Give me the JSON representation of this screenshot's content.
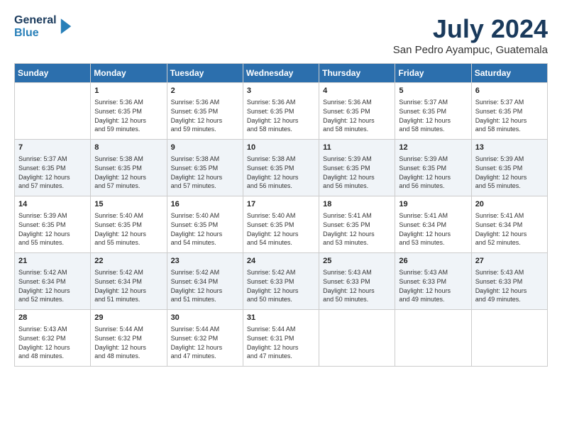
{
  "header": {
    "logo_line1": "General",
    "logo_line2": "Blue",
    "month": "July 2024",
    "location": "San Pedro Ayampuc, Guatemala"
  },
  "days_of_week": [
    "Sunday",
    "Monday",
    "Tuesday",
    "Wednesday",
    "Thursday",
    "Friday",
    "Saturday"
  ],
  "weeks": [
    [
      {
        "day": "",
        "content": ""
      },
      {
        "day": "1",
        "content": "Sunrise: 5:36 AM\nSunset: 6:35 PM\nDaylight: 12 hours\nand 59 minutes."
      },
      {
        "day": "2",
        "content": "Sunrise: 5:36 AM\nSunset: 6:35 PM\nDaylight: 12 hours\nand 59 minutes."
      },
      {
        "day": "3",
        "content": "Sunrise: 5:36 AM\nSunset: 6:35 PM\nDaylight: 12 hours\nand 58 minutes."
      },
      {
        "day": "4",
        "content": "Sunrise: 5:36 AM\nSunset: 6:35 PM\nDaylight: 12 hours\nand 58 minutes."
      },
      {
        "day": "5",
        "content": "Sunrise: 5:37 AM\nSunset: 6:35 PM\nDaylight: 12 hours\nand 58 minutes."
      },
      {
        "day": "6",
        "content": "Sunrise: 5:37 AM\nSunset: 6:35 PM\nDaylight: 12 hours\nand 58 minutes."
      }
    ],
    [
      {
        "day": "7",
        "content": "Sunrise: 5:37 AM\nSunset: 6:35 PM\nDaylight: 12 hours\nand 57 minutes."
      },
      {
        "day": "8",
        "content": "Sunrise: 5:38 AM\nSunset: 6:35 PM\nDaylight: 12 hours\nand 57 minutes."
      },
      {
        "day": "9",
        "content": "Sunrise: 5:38 AM\nSunset: 6:35 PM\nDaylight: 12 hours\nand 57 minutes."
      },
      {
        "day": "10",
        "content": "Sunrise: 5:38 AM\nSunset: 6:35 PM\nDaylight: 12 hours\nand 56 minutes."
      },
      {
        "day": "11",
        "content": "Sunrise: 5:39 AM\nSunset: 6:35 PM\nDaylight: 12 hours\nand 56 minutes."
      },
      {
        "day": "12",
        "content": "Sunrise: 5:39 AM\nSunset: 6:35 PM\nDaylight: 12 hours\nand 56 minutes."
      },
      {
        "day": "13",
        "content": "Sunrise: 5:39 AM\nSunset: 6:35 PM\nDaylight: 12 hours\nand 55 minutes."
      }
    ],
    [
      {
        "day": "14",
        "content": "Sunrise: 5:39 AM\nSunset: 6:35 PM\nDaylight: 12 hours\nand 55 minutes."
      },
      {
        "day": "15",
        "content": "Sunrise: 5:40 AM\nSunset: 6:35 PM\nDaylight: 12 hours\nand 55 minutes."
      },
      {
        "day": "16",
        "content": "Sunrise: 5:40 AM\nSunset: 6:35 PM\nDaylight: 12 hours\nand 54 minutes."
      },
      {
        "day": "17",
        "content": "Sunrise: 5:40 AM\nSunset: 6:35 PM\nDaylight: 12 hours\nand 54 minutes."
      },
      {
        "day": "18",
        "content": "Sunrise: 5:41 AM\nSunset: 6:35 PM\nDaylight: 12 hours\nand 53 minutes."
      },
      {
        "day": "19",
        "content": "Sunrise: 5:41 AM\nSunset: 6:34 PM\nDaylight: 12 hours\nand 53 minutes."
      },
      {
        "day": "20",
        "content": "Sunrise: 5:41 AM\nSunset: 6:34 PM\nDaylight: 12 hours\nand 52 minutes."
      }
    ],
    [
      {
        "day": "21",
        "content": "Sunrise: 5:42 AM\nSunset: 6:34 PM\nDaylight: 12 hours\nand 52 minutes."
      },
      {
        "day": "22",
        "content": "Sunrise: 5:42 AM\nSunset: 6:34 PM\nDaylight: 12 hours\nand 51 minutes."
      },
      {
        "day": "23",
        "content": "Sunrise: 5:42 AM\nSunset: 6:34 PM\nDaylight: 12 hours\nand 51 minutes."
      },
      {
        "day": "24",
        "content": "Sunrise: 5:42 AM\nSunset: 6:33 PM\nDaylight: 12 hours\nand 50 minutes."
      },
      {
        "day": "25",
        "content": "Sunrise: 5:43 AM\nSunset: 6:33 PM\nDaylight: 12 hours\nand 50 minutes."
      },
      {
        "day": "26",
        "content": "Sunrise: 5:43 AM\nSunset: 6:33 PM\nDaylight: 12 hours\nand 49 minutes."
      },
      {
        "day": "27",
        "content": "Sunrise: 5:43 AM\nSunset: 6:33 PM\nDaylight: 12 hours\nand 49 minutes."
      }
    ],
    [
      {
        "day": "28",
        "content": "Sunrise: 5:43 AM\nSunset: 6:32 PM\nDaylight: 12 hours\nand 48 minutes."
      },
      {
        "day": "29",
        "content": "Sunrise: 5:44 AM\nSunset: 6:32 PM\nDaylight: 12 hours\nand 48 minutes."
      },
      {
        "day": "30",
        "content": "Sunrise: 5:44 AM\nSunset: 6:32 PM\nDaylight: 12 hours\nand 47 minutes."
      },
      {
        "day": "31",
        "content": "Sunrise: 5:44 AM\nSunset: 6:31 PM\nDaylight: 12 hours\nand 47 minutes."
      },
      {
        "day": "",
        "content": ""
      },
      {
        "day": "",
        "content": ""
      },
      {
        "day": "",
        "content": ""
      }
    ]
  ]
}
